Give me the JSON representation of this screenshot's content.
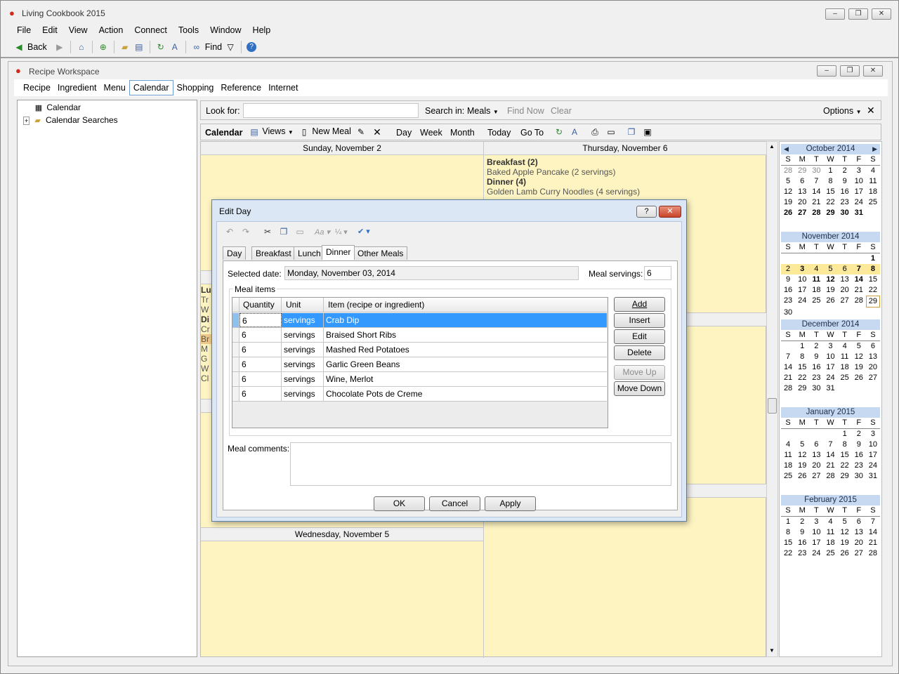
{
  "app": {
    "title": "Living Cookbook 2015"
  },
  "menu": [
    "File",
    "Edit",
    "View",
    "Action",
    "Connect",
    "Tools",
    "Window",
    "Help"
  ],
  "toolbar": {
    "back": "Back",
    "find": "Find"
  },
  "workspace": {
    "title": "Recipe Workspace",
    "tabs": [
      "Recipe",
      "Ingredient",
      "Menu",
      "Calendar",
      "Shopping",
      "Reference",
      "Internet"
    ],
    "selected_tab": "Calendar"
  },
  "tree": {
    "items": [
      "Calendar",
      "Calendar Searches"
    ]
  },
  "search": {
    "look_for": "Look for:",
    "value": "",
    "search_in": "Search in:",
    "scope": "Meals",
    "find_now": "Find Now",
    "clear": "Clear",
    "options": "Options"
  },
  "caltoolbar": {
    "title": "Calendar",
    "views": "Views",
    "new_meal": "New Meal",
    "day": "Day",
    "week": "Week",
    "month": "Month",
    "today": "Today",
    "goto": "Go To"
  },
  "days": {
    "sun": {
      "header": "Sunday, November 2"
    },
    "thu": {
      "header": "Thursday, November 6",
      "breakfast_h": "Breakfast (2)",
      "breakfast_i": "Baked Apple Pancake (2 servings)",
      "dinner_h": "Dinner (4)",
      "dinner_i": "Golden Lamb Curry Noodles (4 servings)"
    },
    "wed": {
      "header": "Wednesday, November 5"
    },
    "mon_partial": [
      "Lu",
      "Tr",
      "W",
      "Di",
      "Cr",
      "Br",
      "M",
      "G",
      "W",
      "Cl"
    ]
  },
  "minicals": [
    {
      "title": "October 2014",
      "dow": [
        "S",
        "M",
        "T",
        "W",
        "T",
        "F",
        "S"
      ],
      "rows": [
        [
          "28",
          "29",
          "30",
          "1",
          "2",
          "3",
          "4"
        ],
        [
          "5",
          "6",
          "7",
          "8",
          "9",
          "10",
          "11"
        ],
        [
          "12",
          "13",
          "14",
          "15",
          "16",
          "17",
          "18"
        ],
        [
          "19",
          "20",
          "21",
          "22",
          "23",
          "24",
          "25"
        ],
        [
          "26",
          "27",
          "28",
          "29",
          "30",
          "31",
          ""
        ]
      ]
    },
    {
      "title": "November 2014",
      "dow": [
        "S",
        "M",
        "T",
        "W",
        "T",
        "F",
        "S"
      ],
      "rows": [
        [
          "",
          "",
          "",
          "",
          "",
          "",
          "1"
        ],
        [
          "2",
          "3",
          "4",
          "5",
          "6",
          "7",
          "8"
        ],
        [
          "9",
          "10",
          "11",
          "12",
          "13",
          "14",
          "15"
        ],
        [
          "16",
          "17",
          "18",
          "19",
          "20",
          "21",
          "22"
        ],
        [
          "23",
          "24",
          "25",
          "26",
          "27",
          "28",
          "29"
        ],
        [
          "30",
          "",
          "",
          "",
          "",
          "",
          ""
        ]
      ]
    },
    {
      "title": "December 2014",
      "dow": [
        "S",
        "M",
        "T",
        "W",
        "T",
        "F",
        "S"
      ],
      "rows": [
        [
          "",
          "1",
          "2",
          "3",
          "4",
          "5",
          "6"
        ],
        [
          "7",
          "8",
          "9",
          "10",
          "11",
          "12",
          "13"
        ],
        [
          "14",
          "15",
          "16",
          "17",
          "18",
          "19",
          "20"
        ],
        [
          "21",
          "22",
          "23",
          "24",
          "25",
          "26",
          "27"
        ],
        [
          "28",
          "29",
          "30",
          "31",
          "",
          "",
          ""
        ]
      ]
    },
    {
      "title": "January 2015",
      "dow": [
        "S",
        "M",
        "T",
        "W",
        "T",
        "F",
        "S"
      ],
      "rows": [
        [
          "",
          "",
          "",
          "",
          "1",
          "2",
          "3"
        ],
        [
          "4",
          "5",
          "6",
          "7",
          "8",
          "9",
          "10"
        ],
        [
          "11",
          "12",
          "13",
          "14",
          "15",
          "16",
          "17"
        ],
        [
          "18",
          "19",
          "20",
          "21",
          "22",
          "23",
          "24"
        ],
        [
          "25",
          "26",
          "27",
          "28",
          "29",
          "30",
          "31"
        ]
      ]
    },
    {
      "title": "February 2015",
      "dow": [
        "S",
        "M",
        "T",
        "W",
        "T",
        "F",
        "S"
      ],
      "rows": [
        [
          "1",
          "2",
          "3",
          "4",
          "5",
          "6",
          "7"
        ],
        [
          "8",
          "9",
          "10",
          "11",
          "12",
          "13",
          "14"
        ],
        [
          "15",
          "16",
          "17",
          "18",
          "19",
          "20",
          "21"
        ],
        [
          "22",
          "23",
          "24",
          "25",
          "26",
          "27",
          "28"
        ]
      ]
    }
  ],
  "dialog": {
    "title": "Edit Day",
    "help": "?",
    "tabs": [
      "Day",
      "Breakfast",
      "Lunch",
      "Dinner",
      "Other Meals"
    ],
    "selected_tab": "Dinner",
    "selected_date_label": "Selected date:",
    "selected_date": "Monday, November 03, 2014",
    "meal_servings_label": "Meal servings:",
    "meal_servings": "6",
    "meal_items_label": "Meal items",
    "columns": [
      "Quantity",
      "Unit",
      "Item (recipe or ingredient)"
    ],
    "items": [
      {
        "qty": "6",
        "unit": "servings",
        "item": "Crab Dip"
      },
      {
        "qty": "6",
        "unit": "servings",
        "item": "Braised Short Ribs"
      },
      {
        "qty": "6",
        "unit": "servings",
        "item": "Mashed Red Potatoes"
      },
      {
        "qty": "6",
        "unit": "servings",
        "item": "Garlic Green Beans"
      },
      {
        "qty": "6",
        "unit": "servings",
        "item": "Wine, Merlot"
      },
      {
        "qty": "6",
        "unit": "servings",
        "item": "Chocolate Pots de Creme"
      }
    ],
    "side_buttons": {
      "add": "Add",
      "insert": "Insert",
      "edit": "Edit",
      "delete": "Delete",
      "move_up": "Move Up",
      "move_down": "Move Down"
    },
    "meal_comments_label": "Meal comments:",
    "meal_comments": "",
    "ok": "OK",
    "cancel": "Cancel",
    "apply": "Apply"
  }
}
